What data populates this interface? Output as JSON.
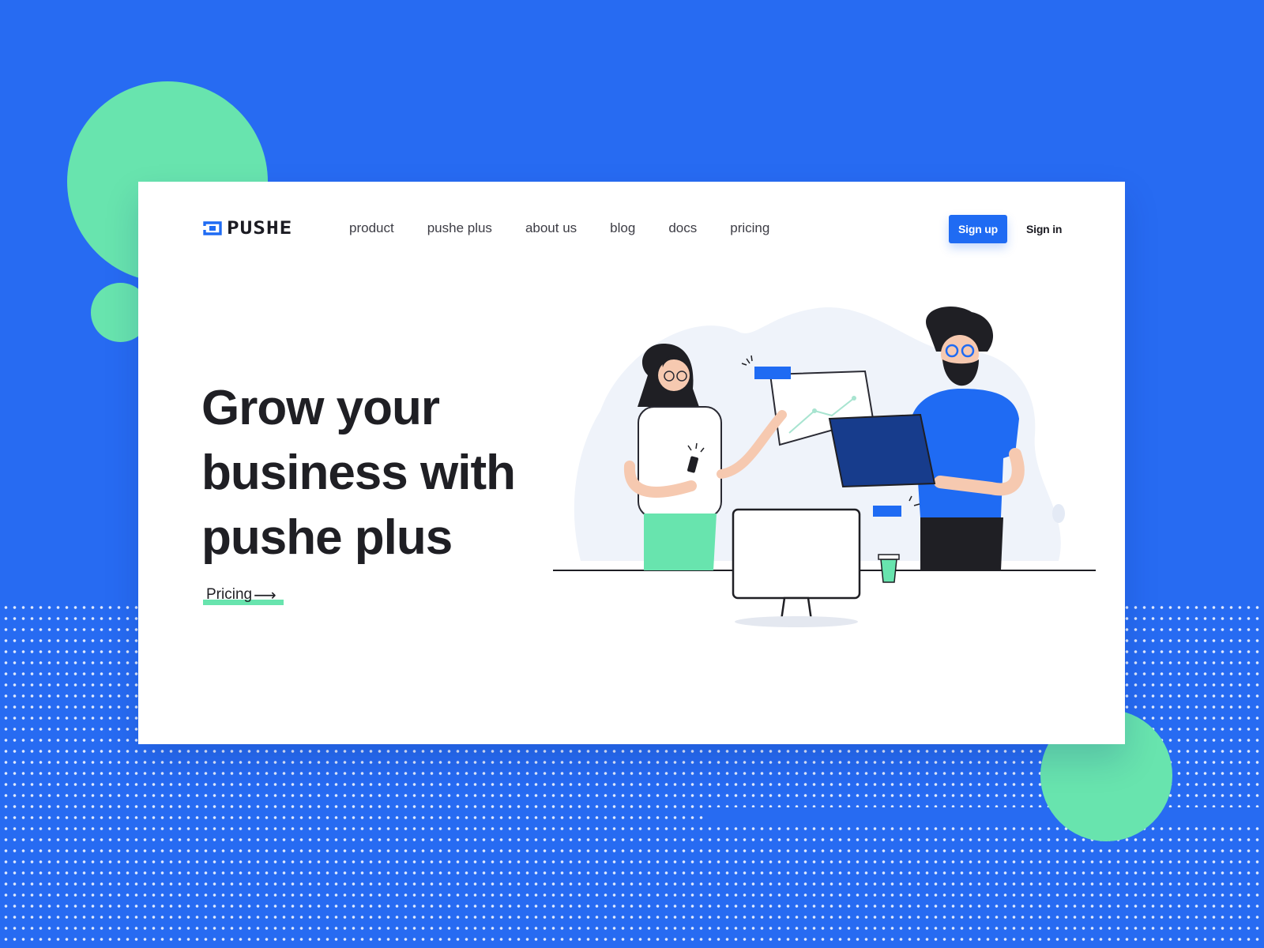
{
  "brand": {
    "logo_text": "PUSHE",
    "accent": "#1F6BF3",
    "mint": "#68E4AE",
    "background": "#276BF2"
  },
  "nav": {
    "items": [
      {
        "label": "product"
      },
      {
        "label": "pushe plus"
      },
      {
        "label": "about us"
      },
      {
        "label": "blog"
      },
      {
        "label": "docs"
      },
      {
        "label": "pricing"
      }
    ]
  },
  "auth": {
    "signup_label": "Sign up",
    "signin_label": "Sign in"
  },
  "hero": {
    "headline_lines": [
      "Grow your",
      "business with",
      "pushe plus"
    ],
    "cta_label": "Pricing",
    "cta_icon": "arrow-right-icon"
  }
}
